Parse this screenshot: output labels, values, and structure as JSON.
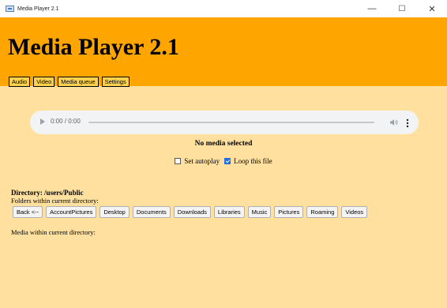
{
  "window": {
    "title": "Media Player 2.1",
    "minimize": "—",
    "maximize": "☐",
    "close": "✕"
  },
  "header": {
    "title": "Media Player 2.1",
    "tabs": [
      "Audio",
      "Video",
      "Media queue",
      "Settings"
    ]
  },
  "player": {
    "time": "0:00 / 0:00",
    "progress": 0,
    "status": "No media selected",
    "autoplay_label": "Set autoplay",
    "autoplay_checked": false,
    "loop_label": "Loop this file",
    "loop_checked": true
  },
  "browser": {
    "directory_label": "Directory: /users/Public",
    "folders_label": "Folders within current directory:",
    "folders": [
      "Back <--",
      "AccountPictures",
      "Desktop",
      "Documents",
      "Downloads",
      "Libraries",
      "Music",
      "Pictures",
      "Roaming",
      "Videos"
    ],
    "media_label": "Media within current directory:"
  },
  "colors": {
    "header": "#ffa500",
    "background": "#ffe09e",
    "checkbox_checked": "#1f6fe0"
  }
}
